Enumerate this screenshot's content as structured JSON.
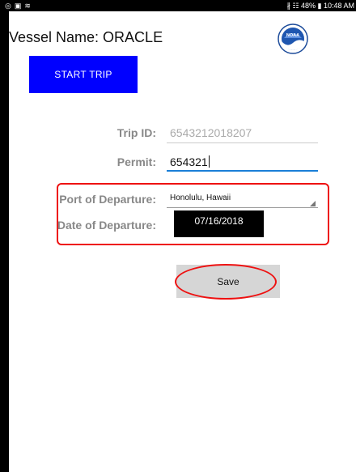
{
  "status_bar": {
    "left_icons": [
      "settings-icon",
      "image-icon",
      "wifi-icon"
    ],
    "right_text": "∦ ☷ 48% ▮ 10:48 AM"
  },
  "vessel": {
    "title": "Vessel Name: ORACLE"
  },
  "logo": {
    "text": "NOAA"
  },
  "start_trip": {
    "label": "START TRIP"
  },
  "form": {
    "trip_id": {
      "label": "Trip ID:",
      "value": "6543212018207"
    },
    "permit": {
      "label": "Permit:",
      "value": "654321"
    },
    "port_of_departure": {
      "label": "Port of Departure:",
      "value": "Honolulu, Hawaii"
    },
    "date_of_departure": {
      "label": "Date of Departure:",
      "value": "07/16/2018"
    }
  },
  "save": {
    "label": "Save"
  },
  "colors": {
    "accent_blue": "#0000ff",
    "highlight_red": "#e11111",
    "focus_line": "#1a7fd8"
  }
}
